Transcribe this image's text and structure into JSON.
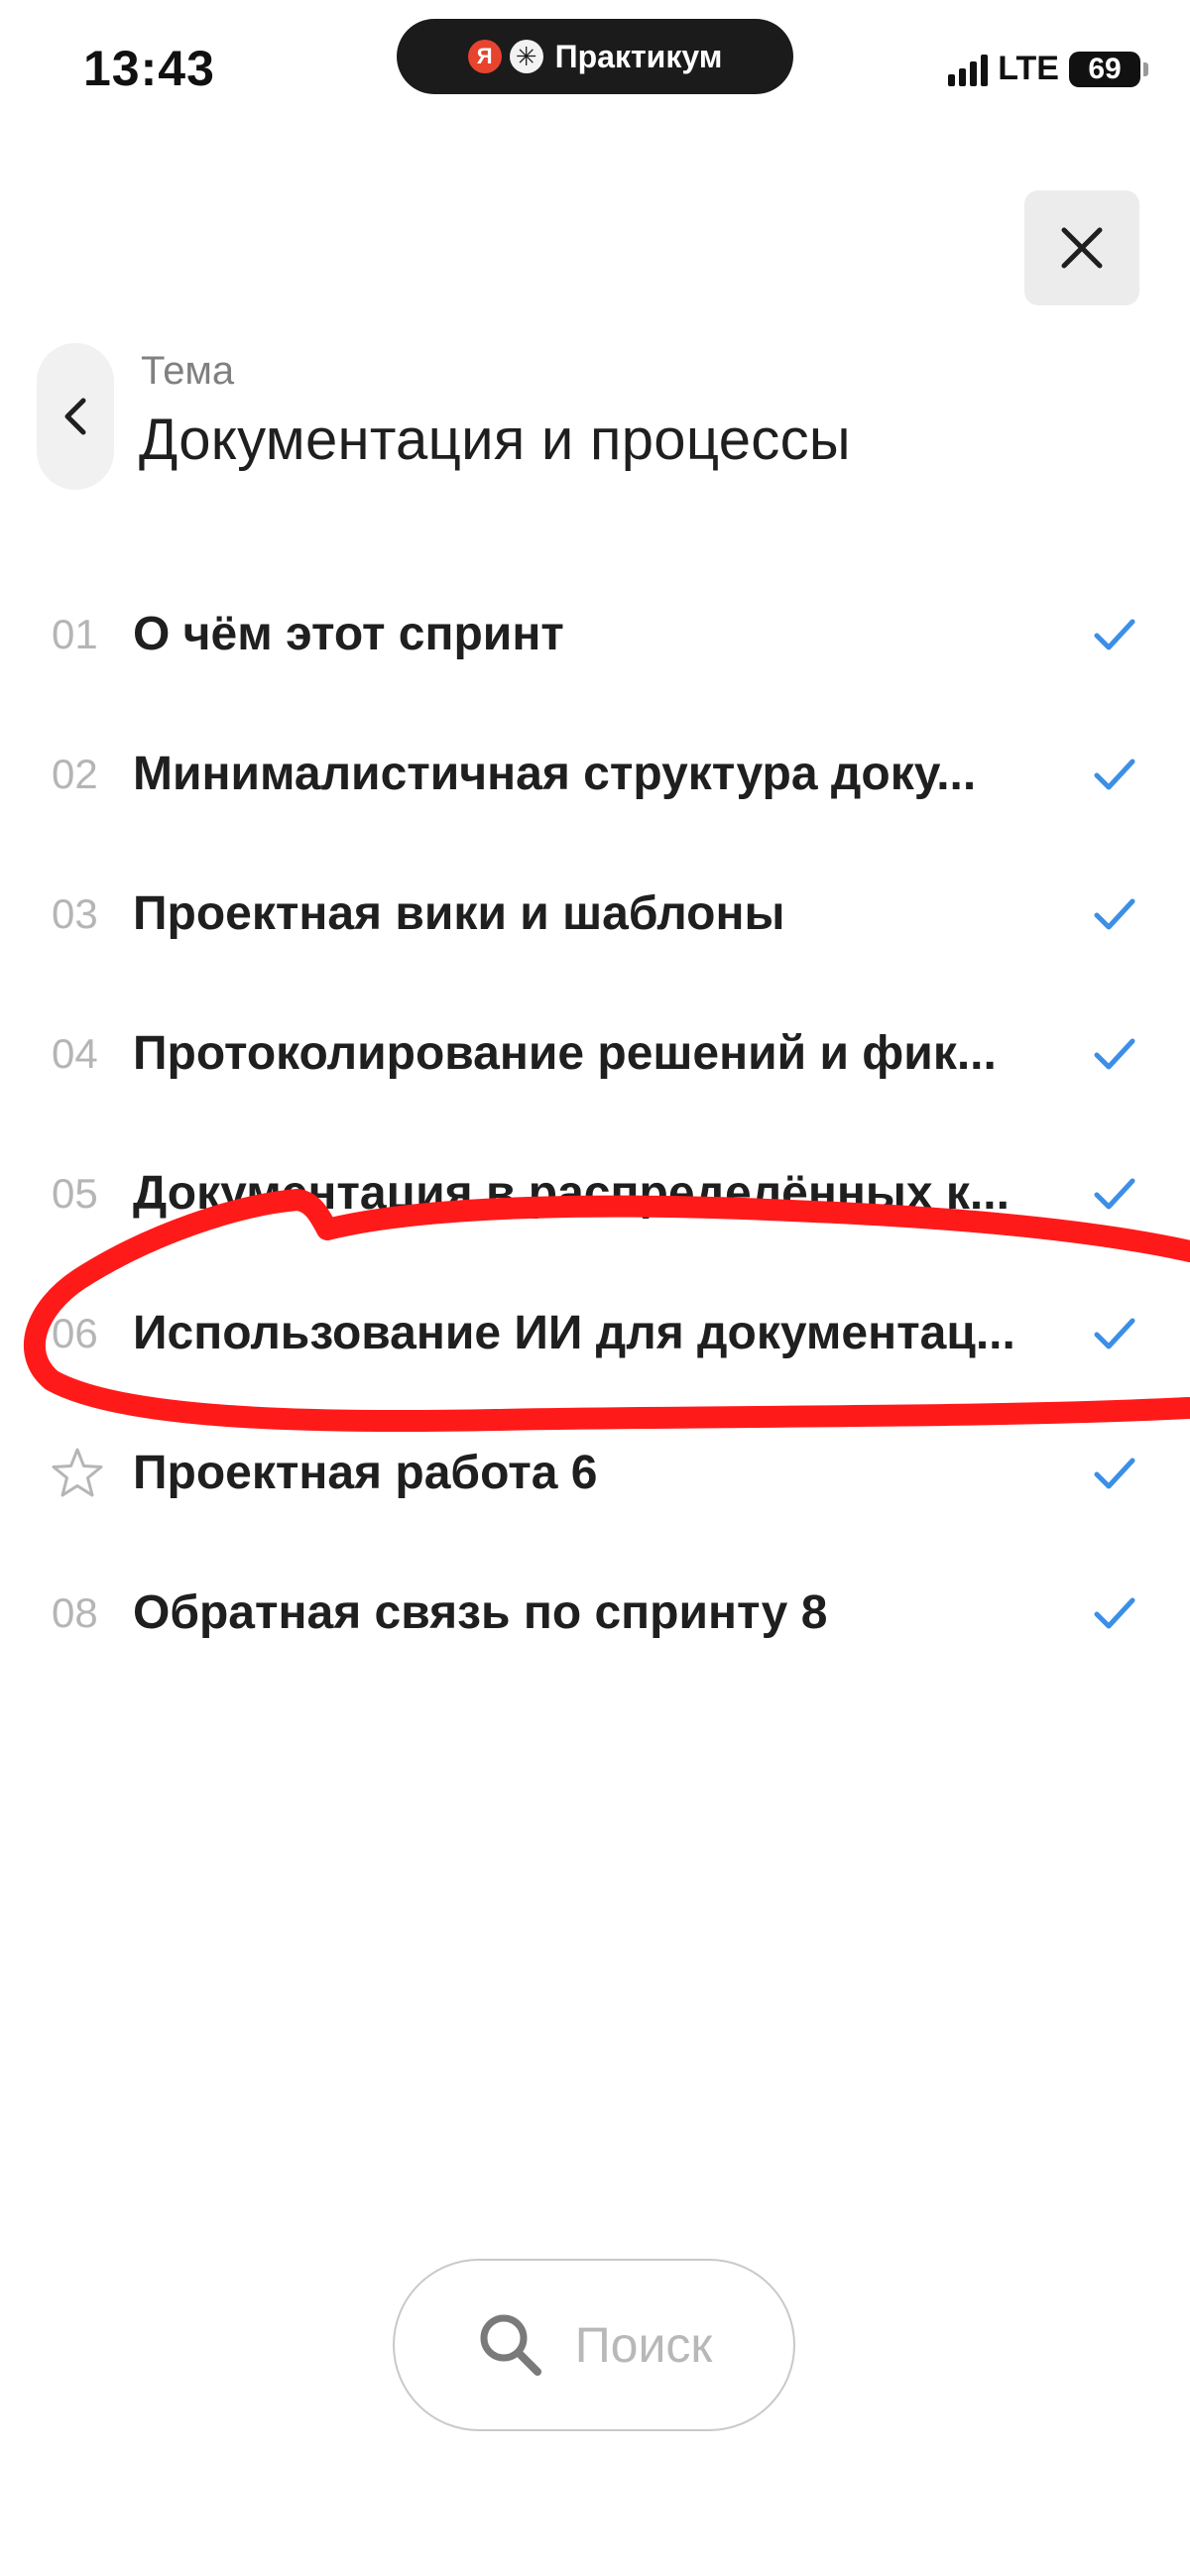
{
  "status_bar": {
    "time": "13:43",
    "app_pill_text": "Практикум",
    "app_logo_letter": "Я",
    "network": "LTE",
    "battery": "69"
  },
  "header": {
    "label": "Тема",
    "title": "Документация и процессы"
  },
  "lessons": [
    {
      "number": "01",
      "title": "О чём этот спринт",
      "completed": true
    },
    {
      "number": "02",
      "title": "Минималистичная структура доку...",
      "completed": true
    },
    {
      "number": "03",
      "title": "Проектная вики и шаблоны",
      "completed": true
    },
    {
      "number": "04",
      "title": "Протоколирование решений и фик...",
      "completed": true
    },
    {
      "number": "05",
      "title": "Документация в распределённых к...",
      "completed": true
    },
    {
      "number": "06",
      "title": "Использование ИИ для документац...",
      "completed": true
    },
    {
      "number": "",
      "title": "Проектная работа 6",
      "completed": true,
      "icon": "star-icon"
    },
    {
      "number": "08",
      "title": "Обратная связь по спринту 8",
      "completed": true
    }
  ],
  "search": {
    "placeholder": "Поиск"
  },
  "colors": {
    "check": "#3b8fe6",
    "annotation": "#ff1a1a",
    "muted_number": "#b5b5b5"
  }
}
